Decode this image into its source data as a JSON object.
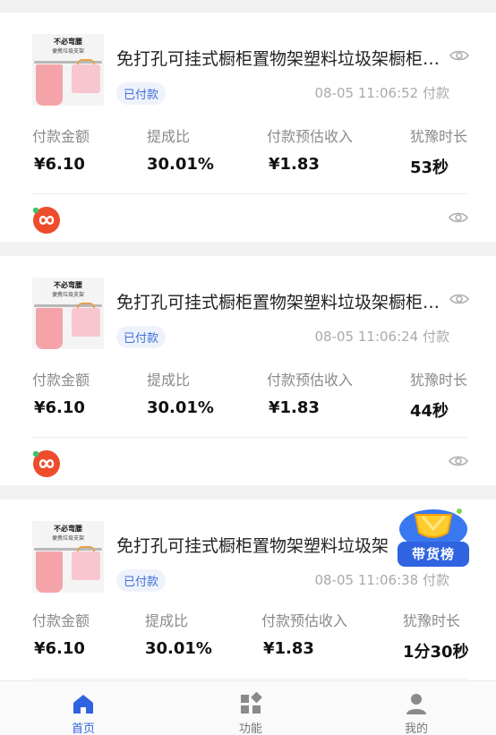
{
  "colors": {
    "accent": "#2f63e0",
    "badge_bg": "#eef2fb",
    "badge_text": "#3f6fd9",
    "bag_pink": "#f4a4a8",
    "app_orange": "#ee4d2d"
  },
  "orders": [
    {
      "thumb_caption_1": "不必弯腰",
      "thumb_caption_2": "便携垃圾支架",
      "title": "免打孔可挂式橱柜置物架塑料垃圾架橱柜门挂式厨房垃圾袋支架",
      "status": "已付款",
      "pay_time": "08-05 11:06:52 付款",
      "labels": [
        "付款金额",
        "提成比",
        "付款预估收入",
        "犹豫时长"
      ],
      "values": [
        "¥6.10",
        "30.01%",
        "¥1.83",
        "53秒"
      ]
    },
    {
      "thumb_caption_1": "不必弯腰",
      "thumb_caption_2": "便携垃圾支架",
      "title": "免打孔可挂式橱柜置物架塑料垃圾架橱柜门挂式厨房垃圾袋支架",
      "status": "已付款",
      "pay_time": "08-05 11:06:24 付款",
      "labels": [
        "付款金额",
        "提成比",
        "付款预估收入",
        "犹豫时长"
      ],
      "values": [
        "¥6.10",
        "30.01%",
        "¥1.83",
        "44秒"
      ]
    },
    {
      "thumb_caption_1": "不必弯腰",
      "thumb_caption_2": "便携垃圾支架",
      "title": "免打孔可挂式橱柜置物架塑料垃圾架",
      "status": "已付款",
      "pay_time": "08-05 11:06:38 付款",
      "labels": [
        "付款金额",
        "提成比",
        "付款预估收入",
        "犹豫时长"
      ],
      "values": [
        "¥6.10",
        "30.01%",
        "¥1.83",
        "1分30秒"
      ]
    }
  ],
  "floating_badge": {
    "label": "带货榜",
    "icon": "trophy-icon"
  },
  "tabbar": {
    "items": [
      {
        "label": "首页",
        "icon": "home-icon",
        "active": true
      },
      {
        "label": "功能",
        "icon": "grid-icon",
        "active": false
      },
      {
        "label": "我的",
        "icon": "user-icon",
        "active": false
      }
    ]
  }
}
